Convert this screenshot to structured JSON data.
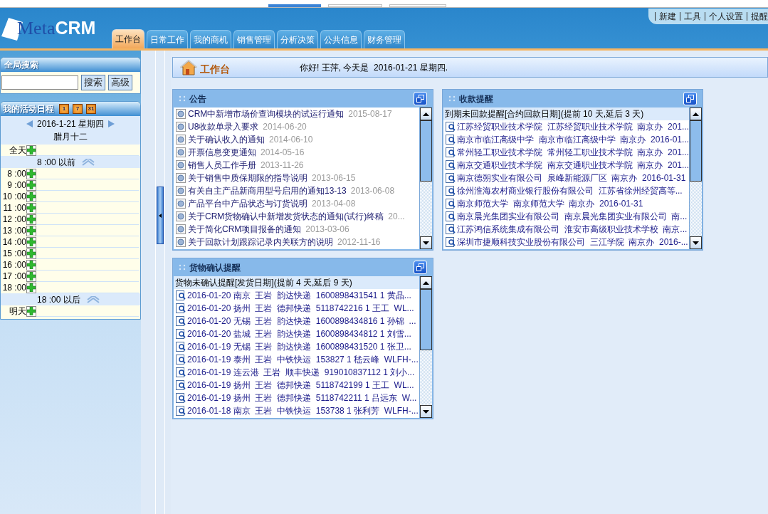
{
  "header": {
    "logo": {
      "light": "Meta",
      "bold": "CRM"
    },
    "top_links": [
      "新建",
      "工具",
      "个人设置",
      "提醒"
    ]
  },
  "tabs": [
    {
      "label": "工作台",
      "selected": true
    },
    {
      "label": "日常工作",
      "selected": false
    },
    {
      "label": "我的商机",
      "selected": false
    },
    {
      "label": "销售管理",
      "selected": false
    },
    {
      "label": "分析决策",
      "selected": false
    },
    {
      "label": "公共信息",
      "selected": false
    },
    {
      "label": "财务管理",
      "selected": false
    }
  ],
  "search": {
    "title": "全局搜索",
    "buttons": [
      "搜索",
      "高级"
    ]
  },
  "schedule": {
    "title": "我的活动日程",
    "view_buttons": [
      "1",
      "7",
      "31"
    ],
    "date": "2016-1-21 星期四",
    "lunar": "腊月十二",
    "slots": [
      {
        "kind": "slot",
        "label": "全天"
      },
      {
        "kind": "band",
        "label": "8 :00 以前"
      },
      {
        "kind": "slot",
        "label": "8 :00"
      },
      {
        "kind": "slot",
        "label": "9 :00"
      },
      {
        "kind": "slot",
        "label": "10 :00"
      },
      {
        "kind": "slot",
        "label": "11 :00"
      },
      {
        "kind": "slot",
        "label": "12 :00"
      },
      {
        "kind": "slot",
        "label": "13 :00"
      },
      {
        "kind": "slot",
        "label": "14 :00"
      },
      {
        "kind": "slot",
        "label": "15 :00"
      },
      {
        "kind": "slot",
        "label": "16 :00"
      },
      {
        "kind": "slot",
        "label": "17 :00"
      },
      {
        "kind": "slot",
        "label": "18 :00"
      },
      {
        "kind": "band",
        "label": "18 :00 以后"
      },
      {
        "kind": "slot",
        "label": "明天"
      }
    ]
  },
  "workspace": {
    "title": "工作台",
    "greeting": "你好! 王萍, 今天是  2016-01-21 星期四."
  },
  "panels": [
    {
      "kind": "notices",
      "title": "公告",
      "rows": [
        {
          "title": "CRM中新增市场价查询模块的试运行通知",
          "date": "2015-08-17"
        },
        {
          "title": "U8收款单录入要求",
          "date": "2014-06-20"
        },
        {
          "title": "关于确认收入的通知",
          "date": "2014-06-10"
        },
        {
          "title": "开票信息变更通知",
          "date": "2014-05-16"
        },
        {
          "title": "销售人员工作手册",
          "date": "2013-11-26"
        },
        {
          "title": "关于销售中质保期限的指导说明",
          "date": "2013-06-15"
        },
        {
          "title": "有关自主产品新商用型号启用的通知13-13",
          "date": "2013-06-08"
        },
        {
          "title": "产品平台中产品状态与订货说明",
          "date": "2013-04-08"
        },
        {
          "title": "关于CRM货物确认中新增发货状态的通知(试行)终稿",
          "date": "20..."
        },
        {
          "title": "关于简化CRM项目报备的通知",
          "date": "2013-03-06"
        },
        {
          "title": "关于回款计划跟踪记录内关联方的说明",
          "date": "2012-11-16"
        }
      ]
    },
    {
      "kind": "reminders",
      "title": "收款提醒",
      "summary": "到期未回款提醒[合约回款日期](提前  10 天,延后  3 天)",
      "rows": [
        {
          "text": "江苏经贸职业技术学院  江苏经贸职业技术学院  南京办  201..."
        },
        {
          "text": "南京市临江高级中学  南京市临江高级中学  南京办  2016-01..."
        },
        {
          "text": "常州轻工职业技术学院  常州轻工职业技术学院  南京办  201..."
        },
        {
          "text": "南京交通职业技术学院  南京交通职业技术学院  南京办  201..."
        },
        {
          "text": "南京德朔实业有限公司  泉峰新能源厂区  南京办  2016-01-31"
        },
        {
          "text": "徐州淮海农村商业银行股份有限公司  江苏省徐州经贸高等..."
        },
        {
          "text": "南京师范大学  南京师范大学  南京办  2016-01-31"
        },
        {
          "text": "南京晨光集团实业有限公司  南京晨光集团实业有限公司  南..."
        },
        {
          "text": "江苏鸿信系统集成有限公司  淮安市高级职业技术学校  南京..."
        },
        {
          "text": "深圳市捷顺科技实业股份有限公司  三江学院  南京办  2016-..."
        }
      ]
    },
    {
      "kind": "reminders",
      "title": "货物确认提醒",
      "summary": "货物未确认提醒[发货日期](提前  4 天,延后  9 天)",
      "rows": [
        {
          "text": "2016-01-20 南京  王岩  韵达快递  1600898431541 1 黄晶..."
        },
        {
          "text": "2016-01-20 扬州  王岩  德邦快递  5118742216 1 王工  WL..."
        },
        {
          "text": "2016-01-20 无锡  王岩  韵达快递  1600898434816 1 孙锦  ..."
        },
        {
          "text": "2016-01-20 盐城  王岩  韵达快递  1600898434812 1 刘雪..."
        },
        {
          "text": "2016-01-19 无锡  王岩  韵达快递  1600898431520 1 张卫..."
        },
        {
          "text": "2016-01-19 泰州  王岩  中铁快运  153827 1 嵇云峰  WLFH-..."
        },
        {
          "text": "2016-01-19 连云港  王岩  顺丰快递  919010837112 1 刘小..."
        },
        {
          "text": "2016-01-19 扬州  王岩  德邦快递  5118742199 1 王工  WL..."
        },
        {
          "text": "2016-01-19 扬州  王岩  德邦快递  5118742211 1 吕远东  W..."
        },
        {
          "text": "2016-01-18 南京  王岩  中铁快运  153738 1 张利芳  WLFH-..."
        }
      ]
    }
  ]
}
